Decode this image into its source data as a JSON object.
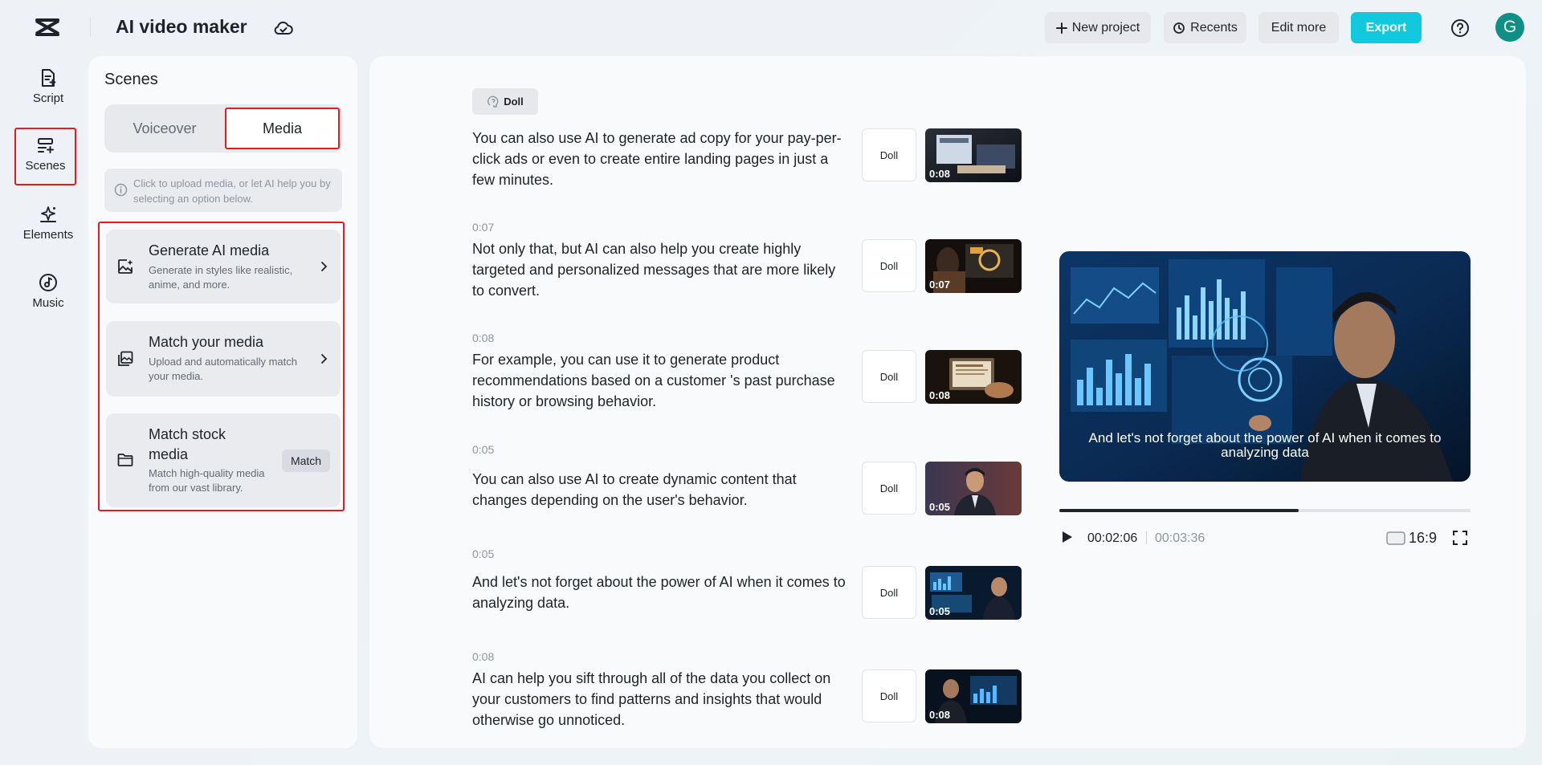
{
  "header": {
    "app_title": "AI video maker",
    "new_project": "New project",
    "recents": "Recents",
    "edit_more": "Edit more",
    "export": "Export",
    "avatar_initial": "G",
    "accent_color": "#10c9dd"
  },
  "sidebar": {
    "items": [
      {
        "label": "Script",
        "icon": "script-icon"
      },
      {
        "label": "Scenes",
        "icon": "scenes-icon"
      },
      {
        "label": "Elements",
        "icon": "elements-icon"
      },
      {
        "label": "Music",
        "icon": "music-icon"
      }
    ]
  },
  "scenes_panel": {
    "title": "Scenes",
    "tabs": [
      "Voiceover",
      "Media"
    ],
    "active_tab": "Media",
    "hint": "Click  to upload media, or let AI help you by selecting an option below.",
    "options": [
      {
        "title": "Generate AI media",
        "desc": "Generate in styles like realistic, anime, and more.",
        "icon": "ai-image-icon"
      },
      {
        "title": "Match your media",
        "desc": "Upload and automatically match your media.",
        "icon": "image-stack-icon"
      },
      {
        "title": "Match stock media",
        "desc": "Match high-quality media from our vast library.",
        "icon": "folder-icon",
        "action": "Match"
      }
    ]
  },
  "main": {
    "voice_tag": "Doll",
    "scenes": [
      {
        "time": "",
        "text": "You can also use AI to generate ad copy for your pay-per-click ads or even to create entire landing pages in just a few minutes.",
        "voice": "Doll",
        "duration": "0:08"
      },
      {
        "time": "0:07",
        "text": "Not only that, but AI can also help you create highly targeted and personalized messages that are more likely to convert.",
        "voice": "Doll",
        "duration": "0:07"
      },
      {
        "time": "0:08",
        "text": "For example, you can use it to generate product recommendations based on a customer 's past purchase history or browsing behavior.",
        "voice": "Doll",
        "duration": "0:08"
      },
      {
        "time": "0:05",
        "text": "You can also use AI to create dynamic content that changes depending on the user's behavior.",
        "voice": "Doll",
        "duration": "0:05"
      },
      {
        "time": "0:05",
        "text": "And let's not forget about the power of AI when it comes to analyzing data.",
        "voice": "Doll",
        "duration": "0:05"
      },
      {
        "time": "0:08",
        "text": "AI can help you sift through all of the data you collect on your customers to find patterns and insights that would otherwise go unnoticed.",
        "voice": "Doll",
        "duration": "0:08"
      }
    ]
  },
  "preview": {
    "caption": "And let's not forget about the power of AI when it comes to analyzing data",
    "current_time": "00:02:06",
    "total_time": "00:03:36",
    "progress": 0.583,
    "aspect_ratio": "16:9"
  }
}
